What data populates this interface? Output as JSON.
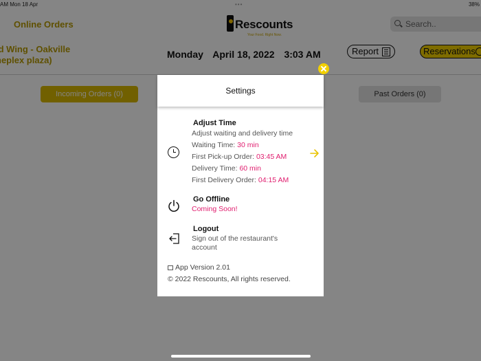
{
  "status_bar": {
    "time": "AM",
    "date": "Mon 18 Apr",
    "battery": "38%"
  },
  "header": {
    "title": "Online Orders",
    "logo_name": "Rescounts",
    "logo_tagline": "Your Food. Right Now.",
    "search_placeholder": "Search..",
    "restaurant_line1": "ld Wing - Oakville",
    "restaurant_line2": "neplex plaza)",
    "day": "Monday",
    "date": "April 18, 2022",
    "time": "3:03 AM",
    "report_label": "Report",
    "reservations_label": "Reservations"
  },
  "tabs": {
    "incoming": "Incoming Orders (0)",
    "past": "Past Orders (0)"
  },
  "settings": {
    "title": "Settings",
    "adjust_time": {
      "title": "Adjust Time",
      "subtitle": "Adjust waiting and delivery time",
      "waiting_label": "Waiting Time:",
      "waiting_value": "30 min",
      "first_pickup_label": "First Pick-up Order:",
      "first_pickup_value": "03:45 AM",
      "delivery_label": "Delivery Time:",
      "delivery_value": "60 min",
      "first_delivery_label": "First Delivery Order:",
      "first_delivery_value": "04:15 AM"
    },
    "go_offline": {
      "title": "Go Offline",
      "status": "Coming Soon!"
    },
    "logout": {
      "title": "Logout",
      "desc_line1": "Sign out of the restaurant's",
      "desc_line2": "account"
    },
    "app_version": "App Version 2.01",
    "copyright": "© 2022 Rescounts, All rights reserved."
  },
  "colors": {
    "accent": "#f2d000",
    "highlight": "#e01d6e",
    "overlay": "#000000"
  },
  "icons": [
    "clock-icon",
    "arrow-right-icon",
    "power-icon",
    "logout-icon",
    "close-icon",
    "search-icon",
    "app-icon"
  ]
}
